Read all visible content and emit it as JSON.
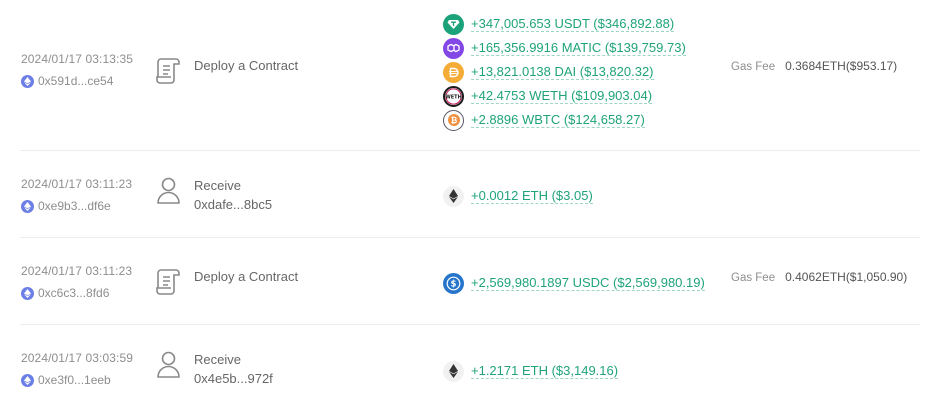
{
  "transactions": [
    {
      "timestamp": "2024/01/17 03:13:35",
      "hash": "0x591d...ce54",
      "action": "Deploy a Contract",
      "action_icon": "contract-scroll-icon",
      "counterparty": "",
      "assets": [
        {
          "coin": "USDT",
          "icon": "usdt-icon",
          "color": "#1ba27a",
          "amount": "+347,005.653 USDT ($346,892.88)"
        },
        {
          "coin": "MATIC",
          "icon": "matic-icon",
          "color": "#8247e5",
          "amount": "+165,356.9916 MATIC ($139,759.73)"
        },
        {
          "coin": "DAI",
          "icon": "dai-icon",
          "color": "#f5ac37",
          "amount": "+13,821.0138 DAI ($13,820.32)"
        },
        {
          "coin": "WETH",
          "icon": "weth-icon",
          "color": "#1a1a1a",
          "amount": "+42.4753 WETH ($109,903.04)"
        },
        {
          "coin": "WBTC",
          "icon": "wbtc-icon",
          "color": "#f09242",
          "amount": "+2.8896 WBTC ($124,658.27)"
        }
      ],
      "fee_label": "Gas Fee",
      "fee": "0.3684ETH($953.17)"
    },
    {
      "timestamp": "2024/01/17 03:11:23",
      "hash": "0xe9b3...df6e",
      "action": "Receive",
      "action_icon": "user-icon",
      "counterparty": "0xdafe...8bc5",
      "assets": [
        {
          "coin": "ETH",
          "icon": "eth-icon",
          "color": "#343434",
          "amount": "+0.0012 ETH ($3.05)"
        }
      ],
      "fee_label": "",
      "fee": ""
    },
    {
      "timestamp": "2024/01/17 03:11:23",
      "hash": "0xc6c3...8fd6",
      "action": "Deploy a Contract",
      "action_icon": "contract-scroll-icon",
      "counterparty": "",
      "assets": [
        {
          "coin": "USDC",
          "icon": "usdc-icon",
          "color": "#2775ca",
          "amount": "+2,569,980.1897 USDC ($2,569,980.19)"
        }
      ],
      "fee_label": "Gas Fee",
      "fee": "0.4062ETH($1,050.90)"
    },
    {
      "timestamp": "2024/01/17 03:03:59",
      "hash": "0xe3f0...1eeb",
      "action": "Receive",
      "action_icon": "user-icon",
      "counterparty": "0x4e5b...972f",
      "assets": [
        {
          "coin": "ETH",
          "icon": "eth-icon",
          "color": "#343434",
          "amount": "+1.2171 ETH ($3,149.16)"
        }
      ],
      "fee_label": "",
      "fee": ""
    }
  ]
}
